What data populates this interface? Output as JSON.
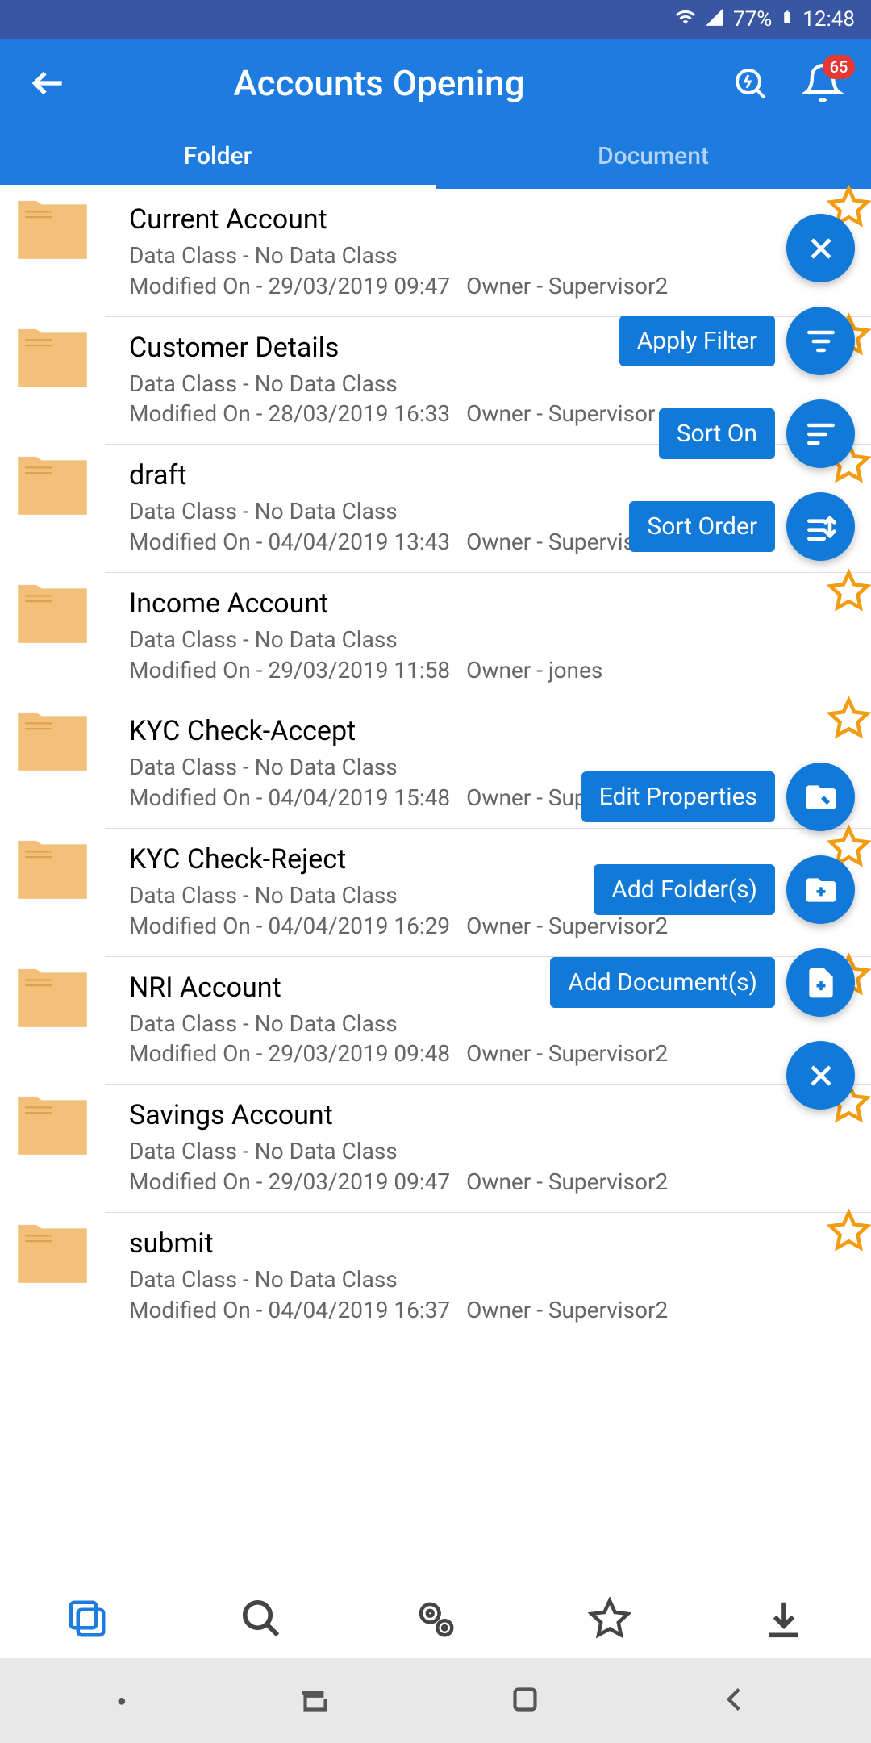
{
  "status": {
    "battery": "77%",
    "time": "12:48"
  },
  "header": {
    "title": "Accounts Opening",
    "notif_count": "65"
  },
  "tabs": {
    "folder": "Folder",
    "document": "Document"
  },
  "items": [
    {
      "title": "Current Account",
      "dataclass": "Data Class - No Data Class",
      "modified": "Modified On - 29/03/2019 09:47",
      "owner": "Owner - Supervisor2"
    },
    {
      "title": "Customer Details",
      "dataclass": "Data Class - No Data Class",
      "modified": "Modified On - 28/03/2019 16:33",
      "owner": "Owner - Supervisor"
    },
    {
      "title": "draft",
      "dataclass": "Data Class - No Data Class",
      "modified": "Modified On - 04/04/2019 13:43",
      "owner": "Owner - Supervisor2"
    },
    {
      "title": "Income Account",
      "dataclass": "Data Class - No Data Class",
      "modified": "Modified On - 29/03/2019 11:58",
      "owner": "Owner - jones"
    },
    {
      "title": "KYC Check-Accept",
      "dataclass": "Data Class - No Data Class",
      "modified": "Modified On - 04/04/2019 15:48",
      "owner": "Owner - Supervisor2"
    },
    {
      "title": "KYC Check-Reject",
      "dataclass": "Data Class - No Data Class",
      "modified": "Modified On - 04/04/2019 16:29",
      "owner": "Owner - Supervisor2"
    },
    {
      "title": "NRI Account",
      "dataclass": "Data Class - No Data Class",
      "modified": "Modified On - 29/03/2019 09:48",
      "owner": "Owner - Supervisor2"
    },
    {
      "title": "Savings Account",
      "dataclass": "Data Class - No Data Class",
      "modified": "Modified On - 29/03/2019 09:47",
      "owner": "Owner - Supervisor2"
    },
    {
      "title": "submit",
      "dataclass": "Data Class - No Data Class",
      "modified": "Modified On - 04/04/2019 16:37",
      "owner": "Owner - Supervisor2"
    }
  ],
  "fab_group_1": {
    "close": "×",
    "apply_filter": "Apply Filter",
    "sort_on": "Sort On",
    "sort_order": "Sort Order"
  },
  "fab_group_2": {
    "edit_properties": "Edit Properties",
    "add_folders": "Add Folder(s)",
    "add_documents": "Add Document(s)",
    "close": "×"
  }
}
